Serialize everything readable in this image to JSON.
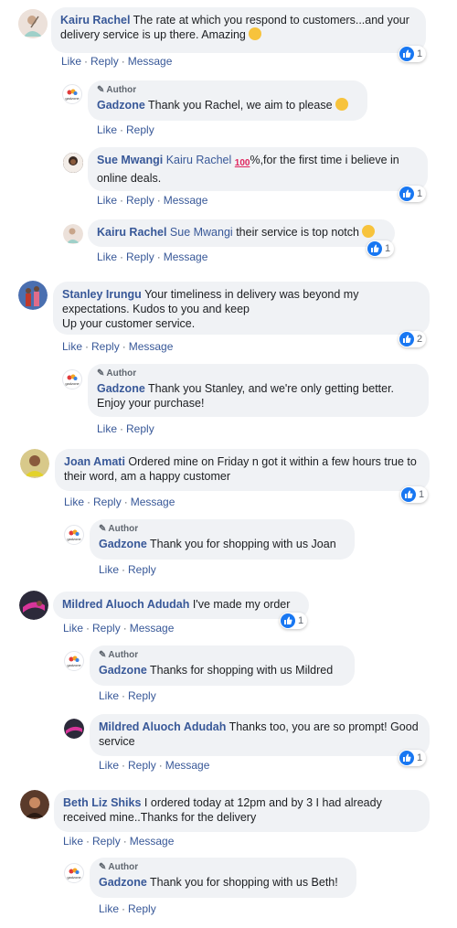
{
  "actions": {
    "like": "Like",
    "reply": "Reply",
    "message": "Message"
  },
  "author_badge": "Author",
  "comments": [
    {
      "name": "Kairu Rachel",
      "text": "The rate at which you respond to customers...and your delivery service is up there. Amazing",
      "emoji": "ok-hand",
      "reactions": "1"
    },
    {
      "name": "Gadzone",
      "text": "Thank you Rachel, we aim to please",
      "emoji": "grin"
    },
    {
      "name": "Sue Mwangi",
      "mention": "Kairu Rachel",
      "text": "%,for the first time i believe in online deals.",
      "emoji": "100",
      "reactions": "1"
    },
    {
      "name": "Kairu Rachel",
      "mention": "Sue Mwangi",
      "text": "their service is top notch",
      "emoji": "ok-hand",
      "reactions": "1"
    },
    {
      "name": "Stanley Irungu",
      "text": "Your timeliness in delivery was beyond my expectations. Kudos to you and keep",
      "text2": "Up your customer service.",
      "reactions": "2"
    },
    {
      "name": "Gadzone",
      "text": "Thank you Stanley, and we're only getting better. Enjoy your purchase!"
    },
    {
      "name": "Joan Amati",
      "text": "Ordered mine on Friday n got it within a few hours true to their word, am a happy customer",
      "reactions": "1"
    },
    {
      "name": "Gadzone",
      "text": "Thank you for shopping with us Joan"
    },
    {
      "name": "Mildred Aluoch Adudah",
      "text": "I've made my order",
      "reactions": "1"
    },
    {
      "name": "Gadzone",
      "text": "Thanks for shopping with us Mildred"
    },
    {
      "name": "Mildred Aluoch Adudah",
      "text": "Thanks too, you are so prompt! Good service",
      "reactions": "1"
    },
    {
      "name": "Beth Liz Shiks",
      "text": "I ordered today at 12pm and by 3 I had already received mine..Thanks for the delivery"
    },
    {
      "name": "Gadzone",
      "text": "Thank you for shopping with us Beth!"
    }
  ],
  "logo_text": "gadzone",
  "colors": {
    "link": "#385898",
    "bubble": "#f0f2f5",
    "like_blue": "#1877f2"
  }
}
